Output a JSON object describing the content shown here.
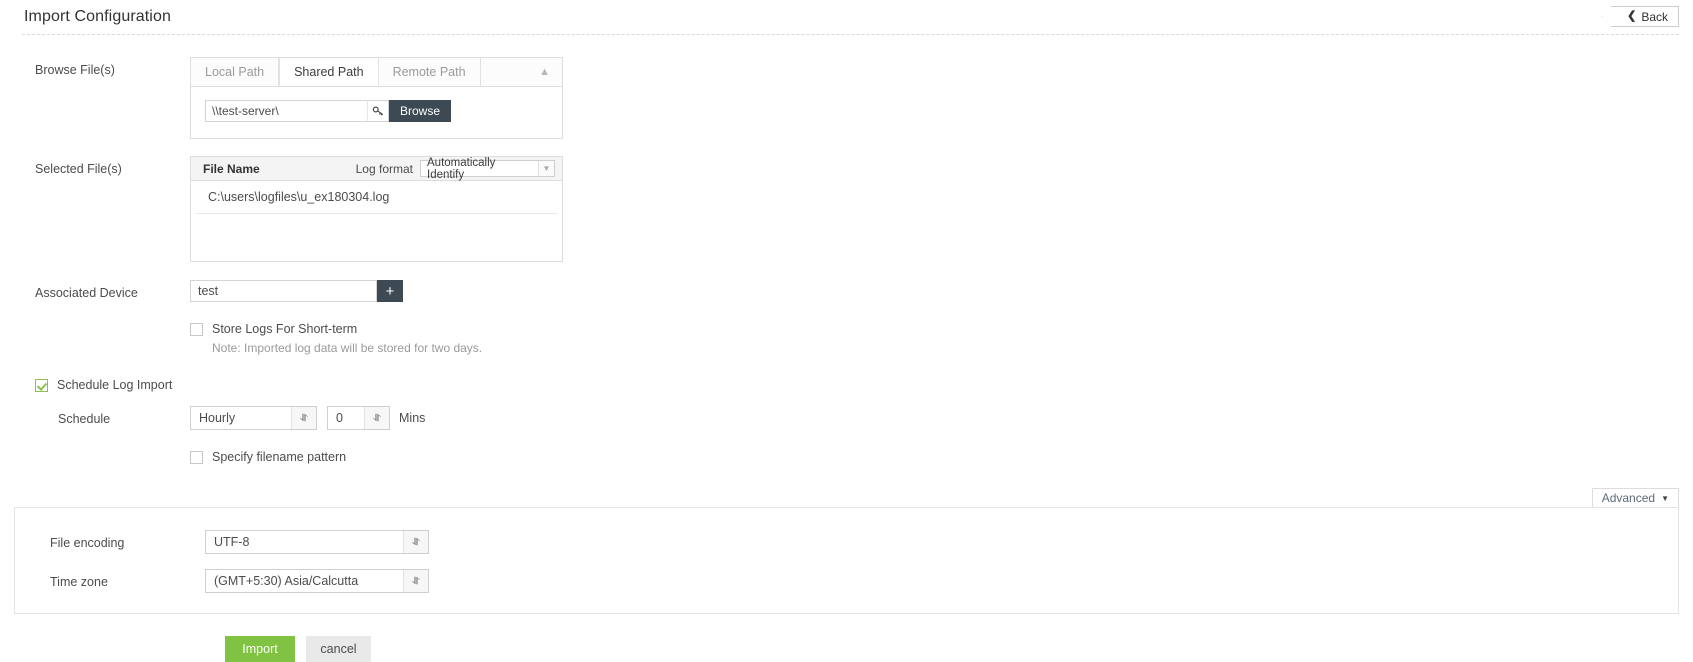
{
  "header": {
    "title": "Import Configuration",
    "back_label": "Back",
    "back_icon": "chevron-left-icon"
  },
  "browse": {
    "label": "Browse File(s)",
    "tabs": [
      {
        "label": "Local Path",
        "active": false
      },
      {
        "label": "Shared Path",
        "active": true
      },
      {
        "label": "Remote Path",
        "active": false
      }
    ],
    "collapse_icon": "chevron-up-icon",
    "path_value": "\\\\test-server\\",
    "path_placeholder": "",
    "credential_icon": "key-icon",
    "browse_button": "Browse"
  },
  "selected_files": {
    "label": "Selected File(s)",
    "column_header": "File Name",
    "log_format_label": "Log format",
    "log_format_value": "Automatically Identify",
    "log_format_arrow_icon": "caret-down-icon",
    "files": [
      "C:\\users\\logfiles\\u_ex180304.log"
    ]
  },
  "associated_device": {
    "label": "Associated Device",
    "value": "test",
    "placeholder": "",
    "add_button_icon": "plus-icon"
  },
  "short_term": {
    "label": "Store Logs For Short-term",
    "checked": false,
    "note": "Note: Imported log data will be stored for two days."
  },
  "schedule_log_import": {
    "label": "Schedule Log Import",
    "checked": true
  },
  "schedule": {
    "label": "Schedule",
    "frequency_value": "Hourly",
    "minutes_value": "0",
    "minutes_unit": "Mins",
    "arrow_icon": "chevron-down-icon"
  },
  "filename_pattern": {
    "label": "Specify filename pattern",
    "checked": false
  },
  "advanced": {
    "toggle_label": "Advanced",
    "toggle_icon": "caret-down-icon",
    "file_encoding_label": "File encoding",
    "file_encoding_value": "UTF-8",
    "time_zone_label": "Time zone",
    "time_zone_value": "(GMT+5:30) Asia/Calcutta"
  },
  "footer": {
    "import_label": "Import",
    "cancel_label": "cancel"
  },
  "colors": {
    "accent_green": "#80c242",
    "dark_button": "#3d4a54",
    "link_blue": "#5b6b7a"
  }
}
